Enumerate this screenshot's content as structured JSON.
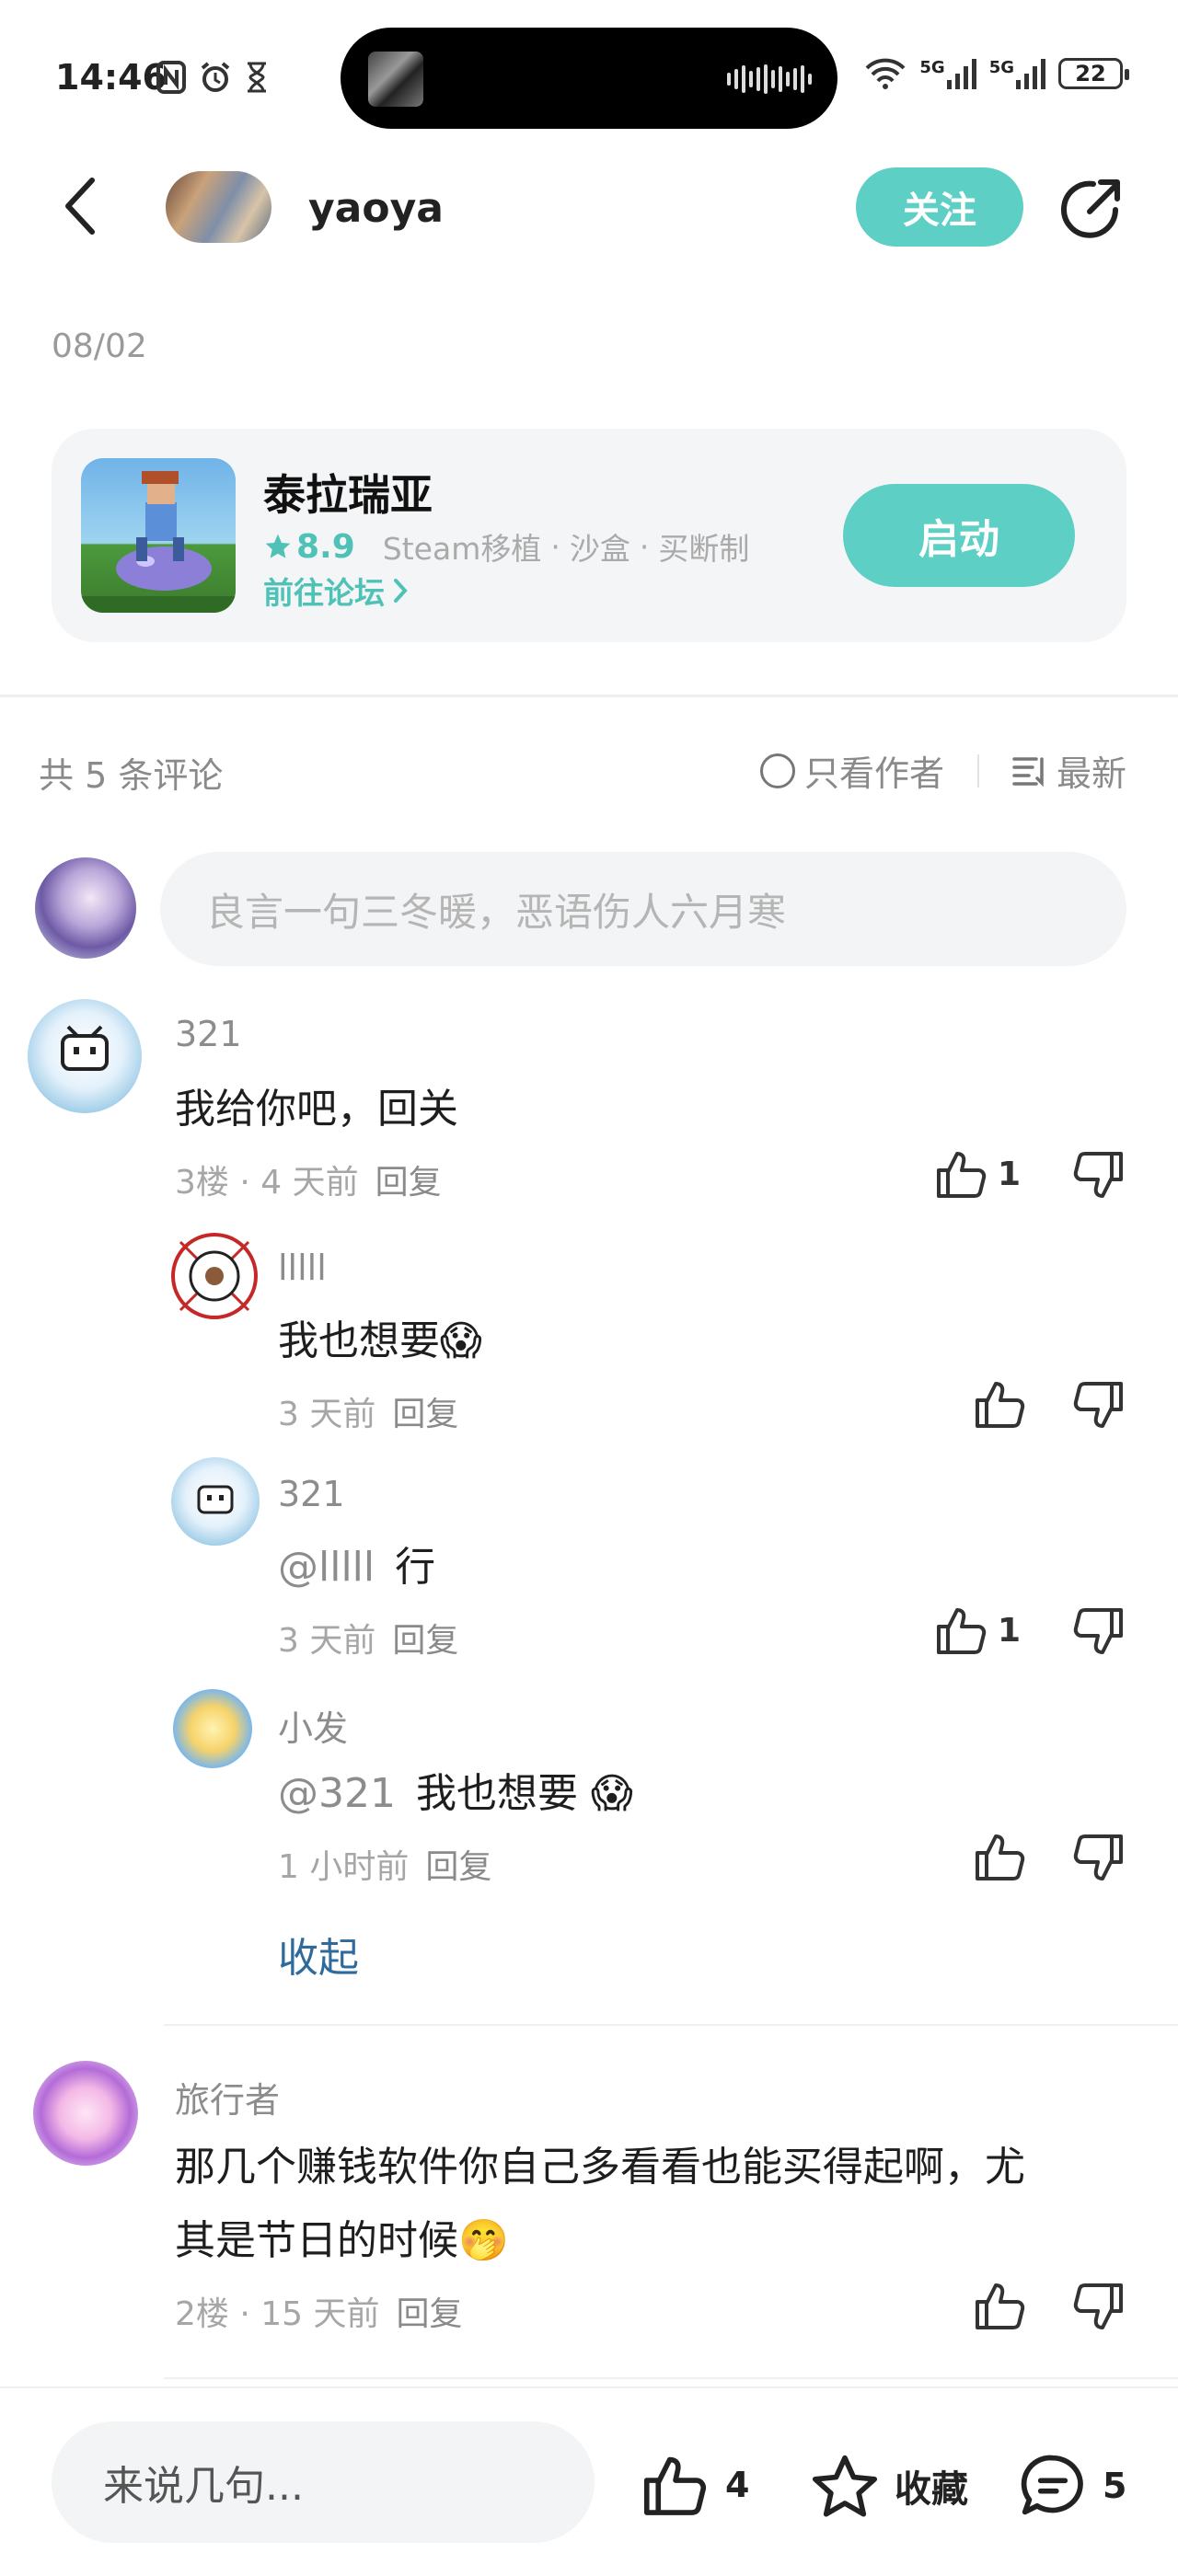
{
  "status_bar": {
    "time": "14:46",
    "network_5g_1": "5G",
    "network_5g_2": "5G",
    "battery": "22"
  },
  "header": {
    "username": "yaoya",
    "follow_label": "关注"
  },
  "post": {
    "date": "08/02"
  },
  "game_card": {
    "title": "泰拉瑞亚",
    "score": "8.9",
    "tags": [
      "Steam移植",
      "沙盒",
      "买断制"
    ],
    "tag_separator": "·",
    "forum_link": "前往论坛",
    "launch_label": "启动"
  },
  "comments_header": {
    "count_label": "共 5 条评论",
    "author_only": "只看作者",
    "sort": "最新"
  },
  "composer": {
    "placeholder": "良言一句三冬暖，恶语伤人六月寒"
  },
  "comments": [
    {
      "user": "321",
      "text": "我给你吧，回关",
      "meta": "3楼 · 4 天前",
      "reply": "回复",
      "likes": "1",
      "replies": [
        {
          "user": "lllll",
          "text": "我也想要😱",
          "meta": "3 天前",
          "reply": "回复",
          "likes": ""
        },
        {
          "user": "321",
          "mention": "@lllll",
          "text": "行",
          "meta": "3 天前",
          "reply": "回复",
          "likes": "1"
        },
        {
          "user": "小发",
          "mention": "@321",
          "text": "我也想要 😱",
          "meta": "1 小时前",
          "reply": "回复",
          "likes": ""
        }
      ],
      "collapse_label": "收起"
    },
    {
      "user": "旅行者",
      "text_line1": "那几个赚钱软件你自己多看看也能买得起啊，尤",
      "text_line2": "其是节日的时候🤭",
      "meta": "2楼 · 15 天前",
      "reply": "回复",
      "likes": ""
    }
  ],
  "bottom_bar": {
    "input_placeholder": "来说几句...",
    "likes": "4",
    "favorite_label": "收藏",
    "comments": "5"
  },
  "colors": {
    "accent": "#5ecfc4",
    "link": "#2f6a9a"
  }
}
